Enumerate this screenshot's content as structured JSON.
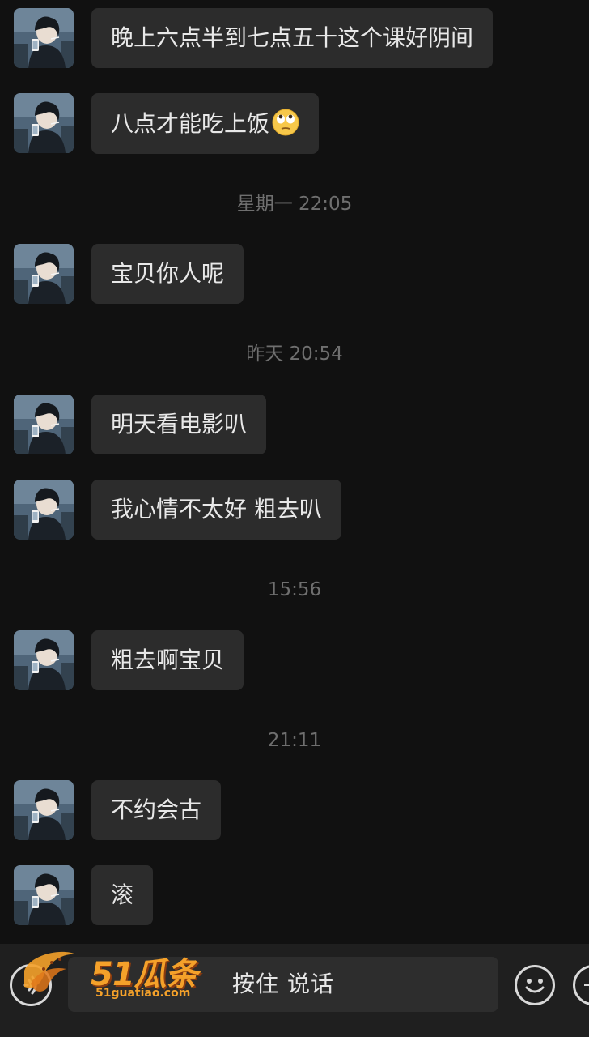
{
  "messages": [
    {
      "text": "晚上六点半到七点五十这个课好阴间",
      "emoji": ""
    },
    {
      "text": "八点才能吃上饭",
      "emoji": "face-with-rolling-eyes"
    },
    {
      "text": "宝贝你人呢",
      "emoji": ""
    },
    {
      "text": "明天看电影叭",
      "emoji": ""
    },
    {
      "text": "我心情不太好 粗去叭",
      "emoji": ""
    },
    {
      "text": "粗去啊宝贝",
      "emoji": ""
    },
    {
      "text": "不约会古",
      "emoji": ""
    },
    {
      "text": "滚",
      "emoji": ""
    }
  ],
  "timestamps": [
    "星期一 22:05",
    "昨天 20:54",
    "15:56",
    "21:11"
  ],
  "input_bar": {
    "hold_to_talk_label": "按住 说话",
    "voice_icon": "voice-icon",
    "emoji_icon": "emoji-icon",
    "plus_icon": "plus-icon"
  },
  "watermark": {
    "brand": "51瓜条",
    "url": "51guatiao.com"
  },
  "colors": {
    "background": "#111111",
    "bubble": "#2c2c2c",
    "text": "#e8e8e8",
    "timestamp": "#6f6f6f",
    "watermark": "#f4a12a"
  }
}
